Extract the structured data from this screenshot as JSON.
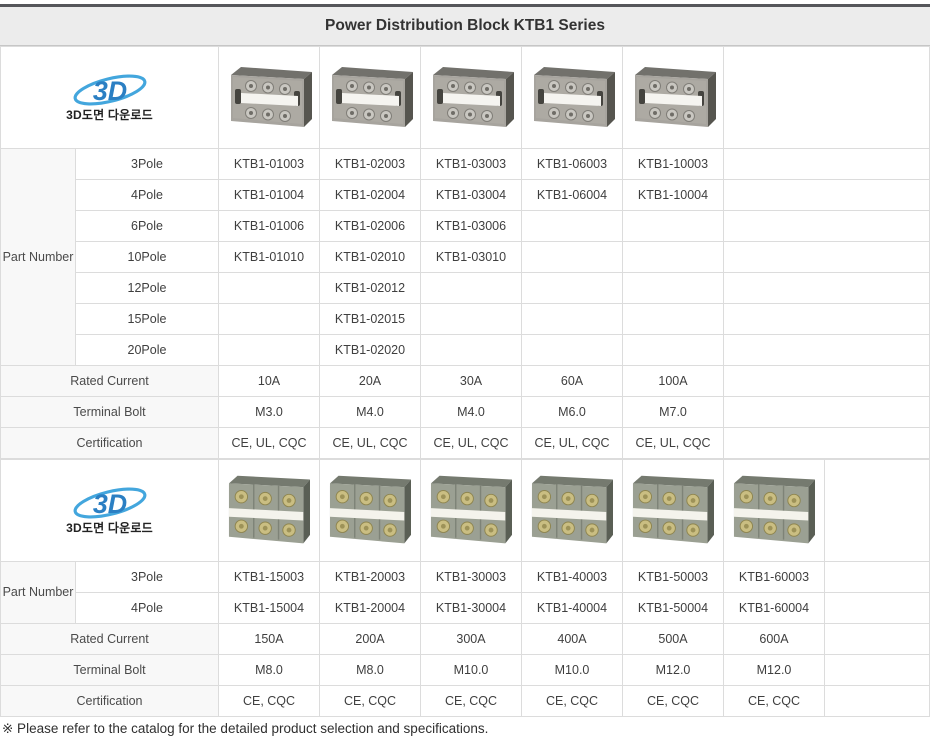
{
  "page": {
    "title": "Power Distribution Block KTB1 Series",
    "footnote": "※ Please refer to the catalog for the detailed product selection and specifications."
  },
  "logo": {
    "mark": "3D",
    "caption": "3D도면 다운로드"
  },
  "colors": {
    "title_bar_bg": "#ececec",
    "title_bar_top_border": "#55565a",
    "grid_line": "#dcdcdc",
    "label_cell_bg": "#f8f8f8",
    "text": "#3f3f3f",
    "logo_blue": "#2b7fc3"
  },
  "tables": [
    {
      "part_label": "Part Number",
      "pole_rows": [
        {
          "label": "3Pole",
          "values": [
            "KTB1-01003",
            "KTB1-02003",
            "KTB1-03003",
            "KTB1-06003",
            "KTB1-10003"
          ]
        },
        {
          "label": "4Pole",
          "values": [
            "KTB1-01004",
            "KTB1-02004",
            "KTB1-03004",
            "KTB1-06004",
            "KTB1-10004"
          ]
        },
        {
          "label": "6Pole",
          "values": [
            "KTB1-01006",
            "KTB1-02006",
            "KTB1-03006",
            "",
            ""
          ]
        },
        {
          "label": "10Pole",
          "values": [
            "KTB1-01010",
            "KTB1-02010",
            "KTB1-03010",
            "",
            ""
          ]
        },
        {
          "label": "12Pole",
          "values": [
            "",
            "KTB1-02012",
            "",
            "",
            ""
          ]
        },
        {
          "label": "15Pole",
          "values": [
            "",
            "KTB1-02015",
            "",
            "",
            ""
          ]
        },
        {
          "label": "20Pole",
          "values": [
            "",
            "KTB1-02020",
            "",
            "",
            ""
          ]
        }
      ],
      "specs": [
        {
          "label": "Rated Current",
          "values": [
            "10A",
            "20A",
            "30A",
            "60A",
            "100A"
          ]
        },
        {
          "label": "Terminal Bolt",
          "values": [
            "M3.0",
            "M4.0",
            "M4.0",
            "M6.0",
            "M7.0"
          ]
        },
        {
          "label": "Certification",
          "values": [
            "CE, UL, CQC",
            "CE, UL, CQC",
            "CE, UL, CQC",
            "CE, UL, CQC",
            "CE, UL, CQC"
          ]
        }
      ]
    },
    {
      "part_label": "Part Number",
      "pole_rows": [
        {
          "label": "3Pole",
          "values": [
            "KTB1-15003",
            "KTB1-20003",
            "KTB1-30003",
            "KTB1-40003",
            "KTB1-50003",
            "KTB1-60003"
          ]
        },
        {
          "label": "4Pole",
          "values": [
            "KTB1-15004",
            "KTB1-20004",
            "KTB1-30004",
            "KTB1-40004",
            "KTB1-50004",
            "KTB1-60004"
          ]
        }
      ],
      "specs": [
        {
          "label": "Rated Current",
          "values": [
            "150A",
            "200A",
            "300A",
            "400A",
            "500A",
            "600A"
          ]
        },
        {
          "label": "Terminal Bolt",
          "values": [
            "M8.0",
            "M8.0",
            "M10.0",
            "M10.0",
            "M12.0",
            "M12.0"
          ]
        },
        {
          "label": "Certification",
          "values": [
            "CE, CQC",
            "CE, CQC",
            "CE, CQC",
            "CE, CQC",
            "CE, CQC",
            "CE, CQC"
          ]
        }
      ]
    }
  ]
}
